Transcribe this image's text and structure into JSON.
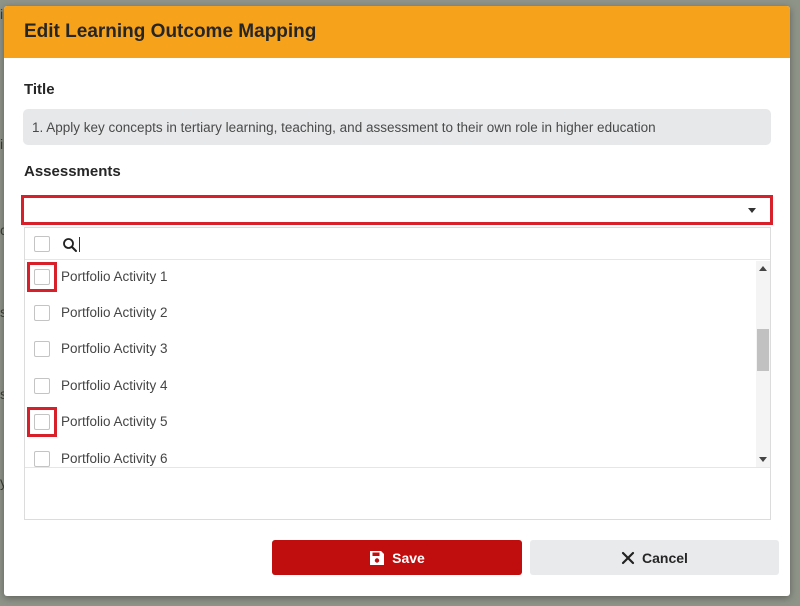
{
  "background": {
    "glyphs": [
      "i",
      "c",
      "s",
      "s",
      "y"
    ]
  },
  "modal": {
    "header_title": "Edit Learning Outcome Mapping",
    "title_field": {
      "label": "Title",
      "value": "1. Apply key concepts in tertiary learning, teaching, and assessment to their own role in higher education"
    },
    "assessments_field": {
      "label": "Assessments",
      "selected_value": "",
      "options": [
        {
          "label": "Portfolio Activity 1",
          "checked": false,
          "highlighted": true
        },
        {
          "label": "Portfolio Activity 2",
          "checked": false,
          "highlighted": false
        },
        {
          "label": "Portfolio Activity 3",
          "checked": false,
          "highlighted": false
        },
        {
          "label": "Portfolio Activity 4",
          "checked": false,
          "highlighted": false
        },
        {
          "label": "Portfolio Activity 5",
          "checked": false,
          "highlighted": true
        },
        {
          "label": "Portfolio Activity 6",
          "checked": false,
          "highlighted": false
        }
      ]
    },
    "buttons": {
      "save_label": "Save",
      "cancel_label": "Cancel"
    }
  },
  "colors": {
    "header": "#f7a21b",
    "save_button": "#c00d0d",
    "cancel_button": "#e8eaec",
    "highlight": "#d7202a"
  }
}
